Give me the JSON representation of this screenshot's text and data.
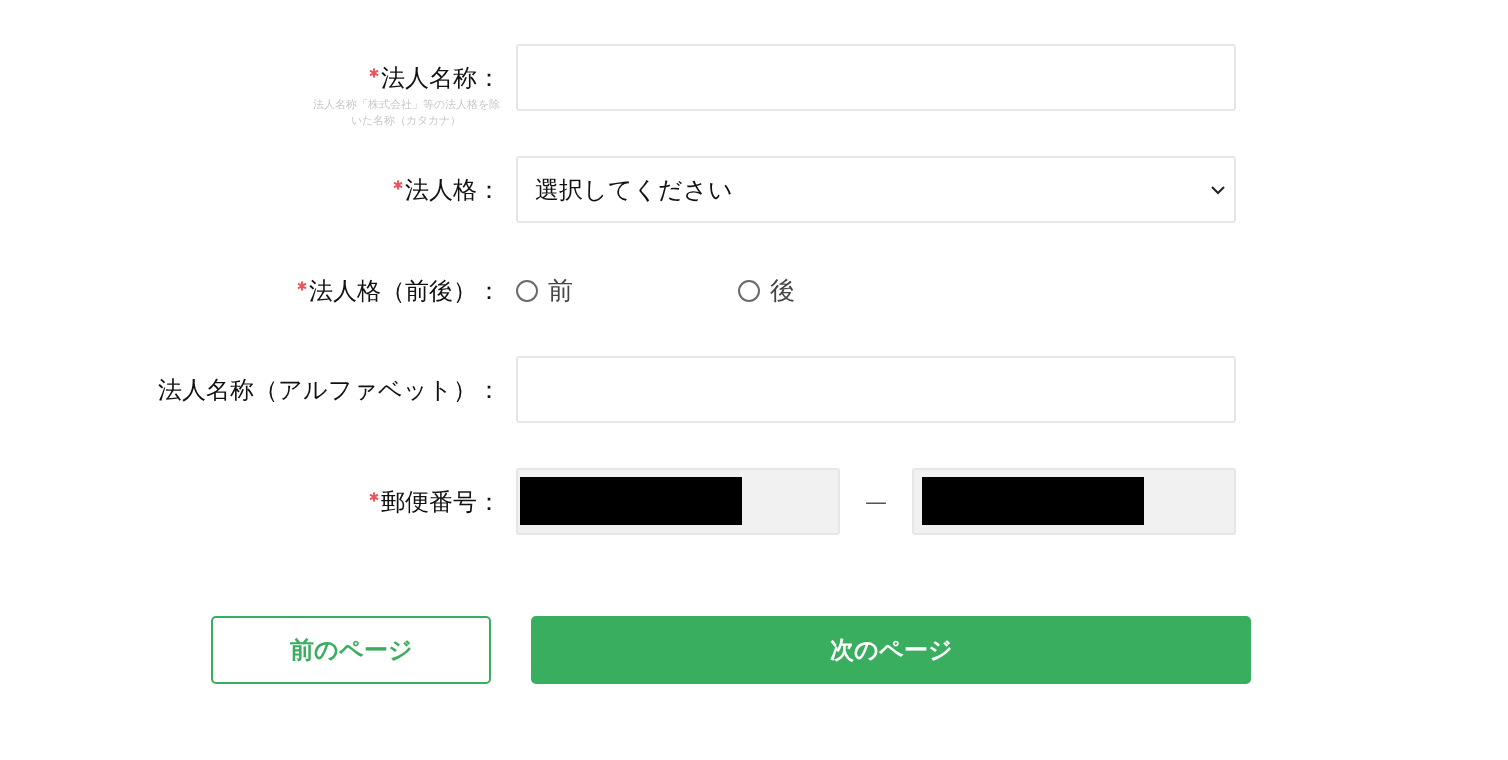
{
  "fields": [
    {
      "kind": "text",
      "required": true,
      "label": "法人名称：",
      "hint": "法人名称「株式会社」等の法人格を除いた名称（カタカナ）"
    },
    {
      "kind": "select",
      "required": true,
      "label": "法人格：",
      "value": "選択してください"
    },
    {
      "kind": "radio",
      "required": true,
      "label": "法人格（前後）：",
      "options": [
        {
          "label": "前",
          "selected": false
        },
        {
          "label": "後",
          "selected": false
        }
      ]
    },
    {
      "kind": "text",
      "required": false,
      "label": "法人名称（アルファベット）："
    },
    {
      "kind": "postal",
      "required": true,
      "label": "郵便番号：",
      "separator": "—",
      "disabled": true
    }
  ],
  "buttons": {
    "back": "前のページ",
    "next": "次のページ"
  }
}
